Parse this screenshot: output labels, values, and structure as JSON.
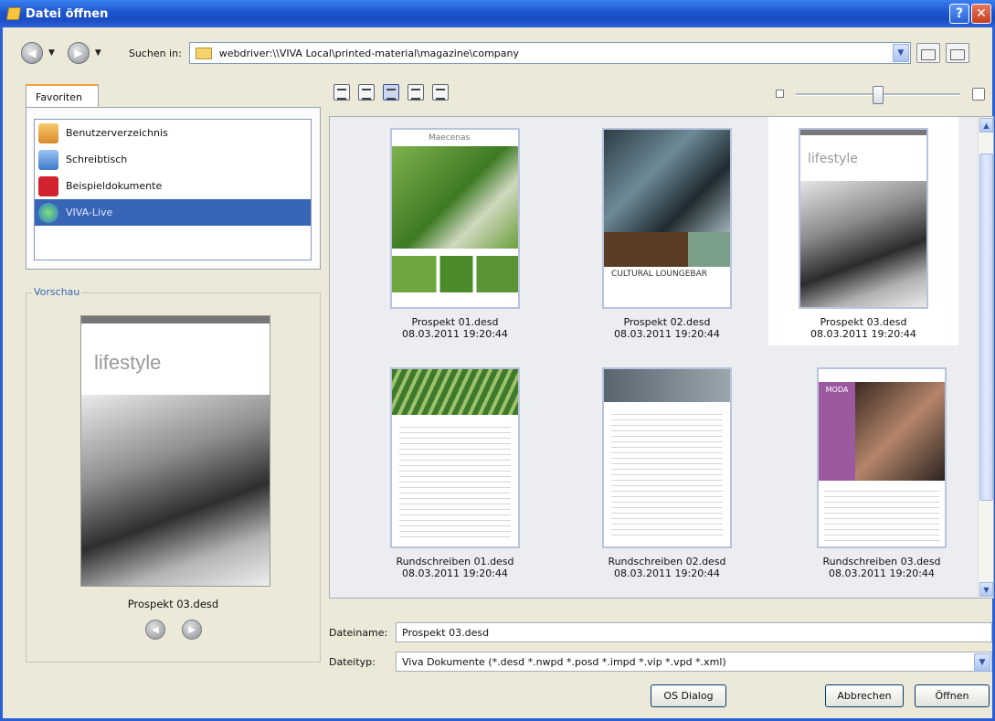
{
  "window": {
    "title": "Datei öffnen",
    "help_label": "?",
    "close_label": "✕"
  },
  "toolbar": {
    "look_in_label": "Suchen in:",
    "path": "webdriver:\\\\VIVA Local\\printed-material\\magazine\\company"
  },
  "favorites": {
    "tab_label": "Favoriten",
    "items": [
      {
        "label": "Benutzerverzeichnis",
        "icon": "home-folder-icon"
      },
      {
        "label": "Schreibtisch",
        "icon": "desktop-icon"
      },
      {
        "label": "Beispieldokumente",
        "icon": "viva-logo-icon"
      },
      {
        "label": "VIVA-Live",
        "icon": "globe-icon"
      }
    ]
  },
  "preview": {
    "group_label": "Vorschau",
    "page_heading": "lifestyle",
    "caption": "Prospekt 03.desd"
  },
  "files": [
    {
      "name": "Prospekt 01.desd",
      "date": "08.03.2011 19:20:44",
      "heading": "Maecenas"
    },
    {
      "name": "Prospekt 02.desd",
      "date": "08.03.2011 19:20:44",
      "heading": "CULTURAL LOUNGEBAR"
    },
    {
      "name": "Prospekt 03.desd",
      "date": "08.03.2011 19:20:44",
      "heading": "lifestyle"
    },
    {
      "name": "Rundschreiben 01.desd",
      "date": "08.03.2011 19:20:44",
      "heading": ""
    },
    {
      "name": "Rundschreiben 02.desd",
      "date": "08.03.2011 19:20:44",
      "heading": ""
    },
    {
      "name": "Rundschreiben 03.desd",
      "date": "08.03.2011 19:20:44",
      "heading": "MODA"
    }
  ],
  "selected_index": 2,
  "zoom_level": 0.5,
  "form": {
    "filename_label": "Dateiname:",
    "filename_value": "Prospekt 03.desd",
    "filetype_label": "Dateityp:",
    "filetype_value": "Viva Dokumente (*.desd *.nwpd *.posd *.impd *.vip *.vpd *.xml)"
  },
  "buttons": {
    "os_dialog": "OS Dialog",
    "cancel": "Abbrechen",
    "open": "Öffnen"
  },
  "colors": {
    "title_bar": "#1d55cf",
    "selection": "#3965b7",
    "accent_tab": "#f0a23c"
  }
}
